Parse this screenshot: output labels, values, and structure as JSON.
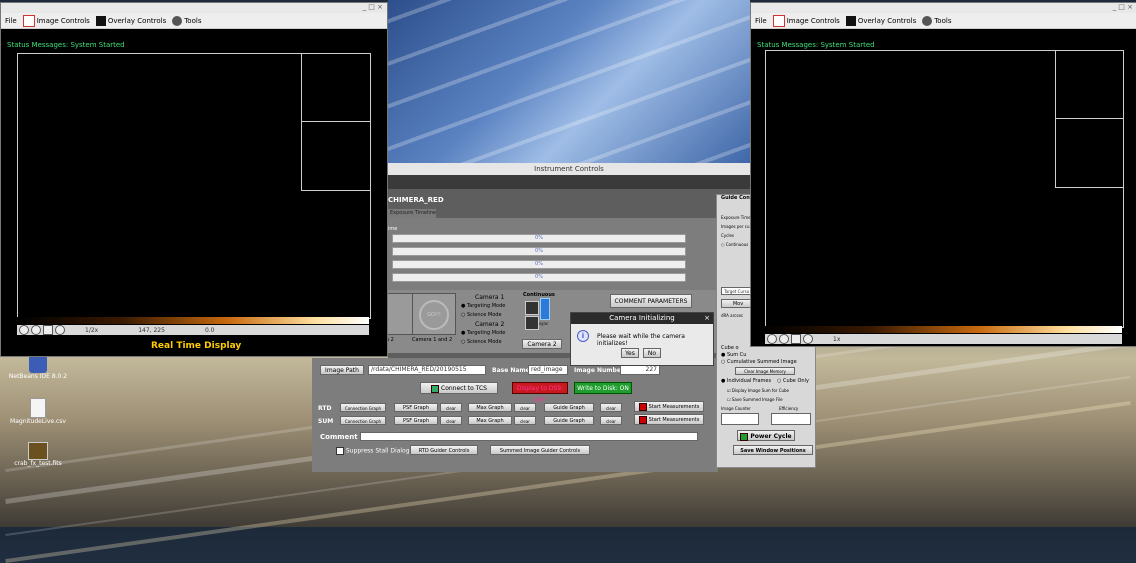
{
  "left_window": {
    "menu": [
      "File",
      "Image Controls",
      "Overlay Controls",
      "Tools"
    ],
    "status": "Status Messages: System Started",
    "zoom": "1/2x",
    "coords": "147, 225",
    "value": "0.0",
    "label": "Real Time Display"
  },
  "right_window": {
    "menu": [
      "File",
      "Image Controls",
      "Overlay Controls",
      "Tools"
    ],
    "status": "Status Messages: System Started",
    "zoom": "1x"
  },
  "instrument": {
    "title": "Instrument Controls",
    "camera": "CHIMERA_RED",
    "tab": "Exposure Timeline",
    "progress": [
      "0%",
      "0%",
      "0%",
      "0%"
    ],
    "progress_label": "ime",
    "camera1_label": "Camera 1",
    "camera2_label": "Camera 2",
    "targeting_mode": "Targeting Mode",
    "science_mode": "Science Mode",
    "continuous": "Continuous",
    "sync": "sync",
    "cameras_label_a": "a 2",
    "cameras_label_b": "Camera 1 and 2",
    "camera2_button": "Camera 2",
    "comment_params": "COMMENT PARAMETERS",
    "go": "GO!!!"
  },
  "lower_panel": {
    "image_path_btn": "Image Path",
    "image_path": "/rdata/CHIMERA_RED/20190515",
    "base_name_label": "Base Name",
    "base_name": "red_image",
    "image_number_label": "Image Number",
    "image_number": "227",
    "connect_tcs": "Connect to TCS",
    "display_off": "Display to DS9: OFF",
    "write_disk": "Write to Disk: ON",
    "rtd_label": "RTD",
    "sum_label": "SUM",
    "connection_graph": "Connection Graph",
    "psf_graph": "PSF Graph",
    "clear": "clear",
    "max_graph": "Max Graph",
    "guide_graph": "Guide Graph",
    "start_measurements": "Start Measurements",
    "comment_label": "Comment",
    "suppress": "Suppress Stall Dialog",
    "rtd_guider": "RTD Guider Controls",
    "summed_guider": "Summed Image Guider Controls"
  },
  "guide_panel": {
    "title": "Guide Con",
    "exposure": "Exposure Time",
    "images_per_cube": "Images per cu",
    "cycles": "Cycles",
    "continuous": "Continuous",
    "target_cursor": "Target Curso",
    "move": "Mov",
    "dra": "dRA arcsec",
    "cube": "Cube o",
    "sum_cube": "Sum Cu",
    "cumulative": "Cumulative Summed Image",
    "clear_memory": "Clear Image Memory",
    "individual": "Individual Frames",
    "cube_only": "Cube Only",
    "display_sum": "Display Image Sum for Cube",
    "save_summed": "Save Summed Image File",
    "image_counter": "Image Counter",
    "efficiency": "Efficiency",
    "power_cycle": "Power Cycle",
    "save_window": "Save Window Positions"
  },
  "dialog": {
    "title": "Camera Initializing",
    "message": "Please wait while the camera initializes!",
    "yes": "Yes",
    "no": "No"
  },
  "desktop": {
    "icons": [
      "NetBeans IDE 8.0.2",
      "MagnitudeLive.csv",
      "crab_fx_test.fits"
    ]
  }
}
